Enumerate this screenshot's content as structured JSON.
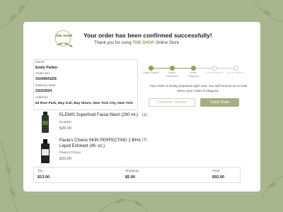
{
  "colors": {
    "background": "#a9b68d",
    "accent": "#8fa055",
    "primary_button": "#a4b080"
  },
  "header": {
    "logo_text": "THE SHOP",
    "title": "Your order has been confirmed successfully!",
    "subtitle_prefix": "Thank you for using ",
    "subtitle_brand": "THE SHOP",
    "subtitle_suffix": " Online Store"
  },
  "order_info": {
    "name_label": "Name",
    "name_value": "Emily Parker",
    "order_no_label": "Order No.",
    "order_no_value": "XGH5641DS",
    "delivery_label": "Delivery Date",
    "delivery_value": "23/2/2024",
    "address_label": "Address",
    "address_value": "64 Rice Park, May trail, Bay Shore, New York City, New York"
  },
  "tracker": {
    "steps": [
      {
        "label": "Order Placed",
        "done": true
      },
      {
        "label": "Order Confirmed",
        "done": true
      },
      {
        "label": "Order Prepared",
        "done": true
      },
      {
        "label": "Order Shipped",
        "done": false
      },
      {
        "label": "Out to Delivery",
        "done": false
      }
    ],
    "status_message": "Your order is being prepared right now. You will receive an E-mail when your order is shipped."
  },
  "buttons": {
    "customer_service": "Customer Service",
    "track_order": "Track Order"
  },
  "products": [
    {
      "name": "ELEMIS Superfood Facial Wash (200 ml.)",
      "brand": "ELEMIS",
      "price": "$39.00",
      "quantity": "(1)",
      "icon": "bottle-icon"
    },
    {
      "name": "Paula's Choice SKIN PERFECTING 2 BHA Liquid Exfoliant (4fl. oz.)",
      "brand": "Paula's Choice",
      "price": "$35.00",
      "quantity": "(1)",
      "icon": "bottle-icon"
    }
  ],
  "totals": {
    "tax_label": "Tax:",
    "tax_value": "$13.00",
    "shipping_label": "Shipping:",
    "shipping_value": "$5.00",
    "total_label": "Total:",
    "total_value": "$92.00"
  }
}
